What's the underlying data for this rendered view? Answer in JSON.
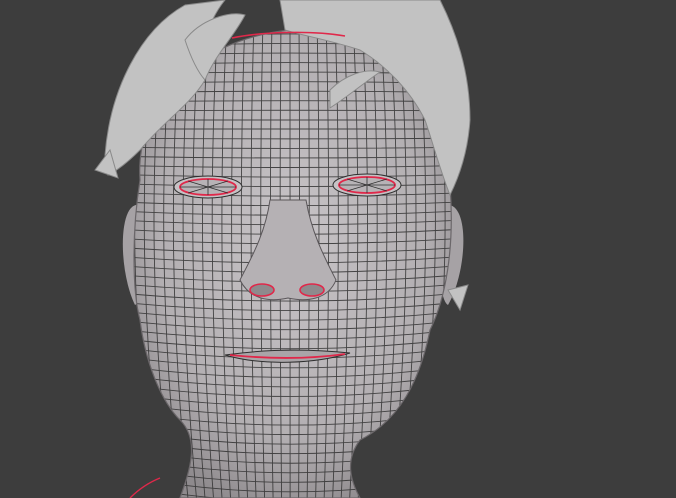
{
  "viewport": {
    "background_color": "#3d3d3d",
    "mesh": {
      "name": "head-sculpt-wireframe",
      "surface_color": "#b9b5b8",
      "hair_color": "#c2c2c2",
      "wire_color": "#2f2f2f",
      "seam_color": "#e0284a",
      "visible_parts": [
        "hair",
        "forehead",
        "left-eye",
        "right-eye",
        "nose",
        "mouth",
        "neck",
        "ears"
      ]
    }
  }
}
